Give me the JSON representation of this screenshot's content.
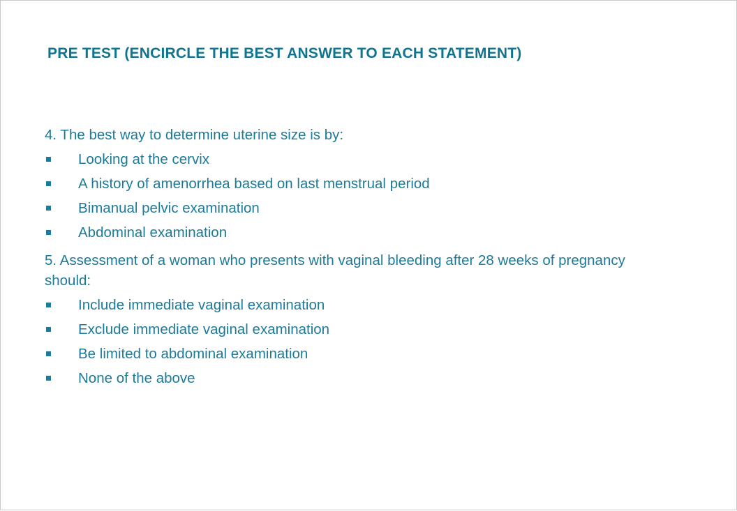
{
  "title": "PRE TEST (ENCIRCLE THE BEST ANSWER TO EACH STATEMENT)",
  "questions": [
    {
      "text": "4. The best way to determine uterine size is by:",
      "options": [
        "Looking at the cervix",
        "A history of amenorrhea based on last menstrual period",
        "Bimanual pelvic examination",
        "Abdominal examination"
      ]
    },
    {
      "text": "5. Assessment of a woman who presents with vaginal bleeding after 28 weeks of pregnancy should:",
      "options": [
        "Include immediate vaginal examination",
        "Exclude immediate vaginal examination",
        "Be limited to abdominal examination",
        "None of the above"
      ]
    }
  ],
  "colors": {
    "title": "#0e7490",
    "text": "#1d7a98",
    "border": "#c8c8c8"
  },
  "icons": {
    "bullet": "square-bullet-icon"
  }
}
